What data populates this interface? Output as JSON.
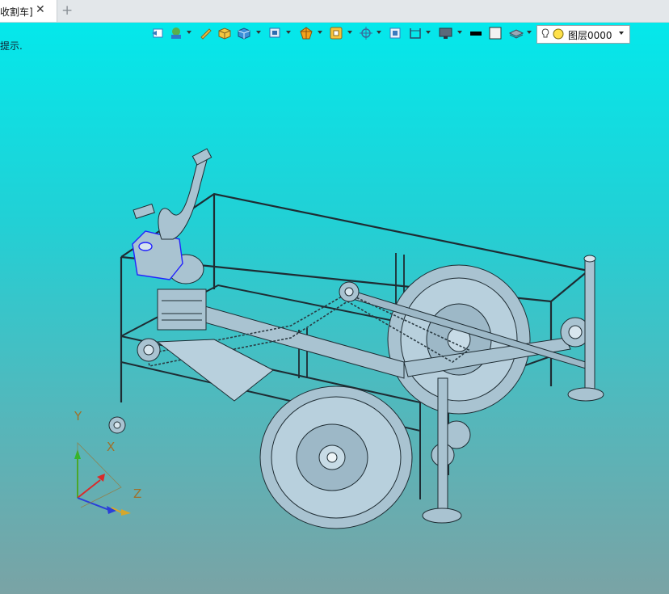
{
  "tab": {
    "title": "收割车]",
    "close_glyph": "✕",
    "add_glyph": "+"
  },
  "viewport": {
    "hint": "提示."
  },
  "toolbar": {
    "tools": [
      "view-restore-icon",
      "render-mode-icon",
      "ruler-icon",
      "box-yellow-icon",
      "cube-blue-icon",
      "view-orient-icon",
      "section-icon",
      "filter-icon",
      "snap-icon",
      "frame-icon",
      "bracket-icon",
      "display-icon",
      "line-color-swatch",
      "fill-swatch",
      "layer-stack-icon"
    ],
    "layer": {
      "name": "图层0000"
    }
  },
  "axes": {
    "x": "X",
    "y": "Y",
    "z": "Z"
  },
  "colors": {
    "viewport_top": "#04e8eb",
    "viewport_bottom": "#7aa3a5",
    "model": "#a9c3d1",
    "edges": "#1e2c33"
  }
}
